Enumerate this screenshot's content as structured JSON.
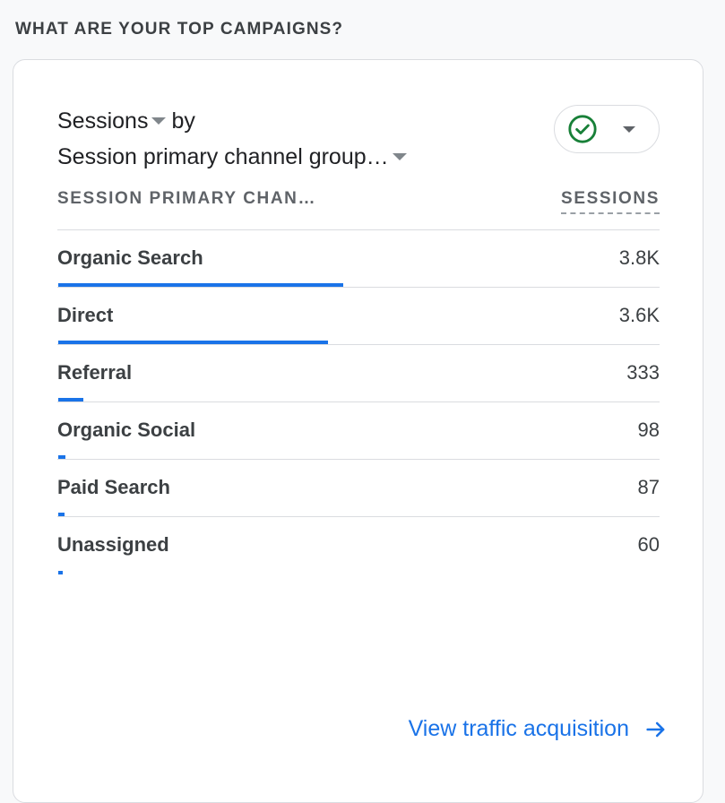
{
  "section": {
    "title": "WHAT ARE YOUR TOP CAMPAIGNS?"
  },
  "card": {
    "metric": "Sessions",
    "by_word": "by",
    "dimension": "Session primary channel group…",
    "status_icon": "check-circle-icon",
    "status_color": "#188038",
    "table": {
      "col_dimension": "SESSION PRIMARY CHAN…",
      "col_metric": "SESSIONS",
      "rows": [
        {
          "label": "Organic Search",
          "value": "3.8K",
          "sessions": 3800
        },
        {
          "label": "Direct",
          "value": "3.6K",
          "sessions": 3600
        },
        {
          "label": "Referral",
          "value": "333",
          "sessions": 333
        },
        {
          "label": "Organic Social",
          "value": "98",
          "sessions": 98
        },
        {
          "label": "Paid Search",
          "value": "87",
          "sessions": 87
        },
        {
          "label": "Unassigned",
          "value": "60",
          "sessions": 60
        }
      ]
    },
    "footer_link": "View traffic acquisition",
    "accent_color": "#1a73e8"
  }
}
